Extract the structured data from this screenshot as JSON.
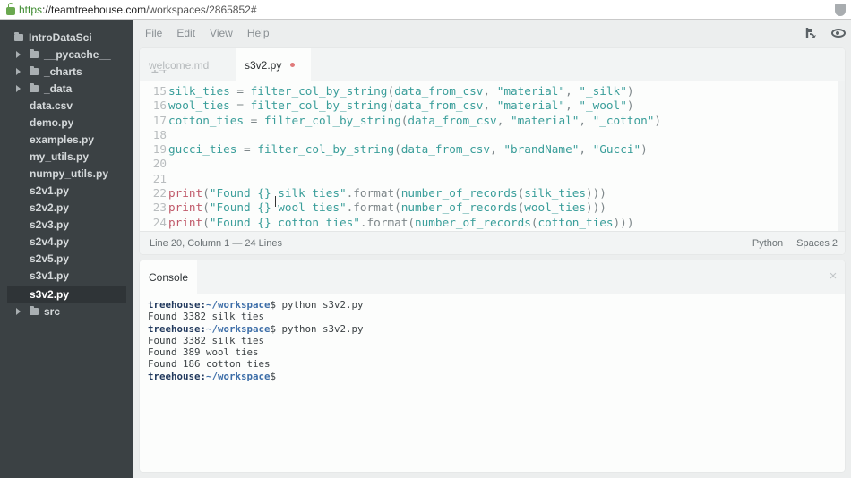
{
  "browser": {
    "url_scheme": "https",
    "url_host": "://teamtreehouse.com",
    "url_path": "/workspaces/2865852#"
  },
  "sidebar": {
    "items": [
      {
        "label": "IntroDataSci",
        "type": "root-folder",
        "expandable": false
      },
      {
        "label": "__pycache__",
        "type": "folder",
        "expandable": true
      },
      {
        "label": "_charts",
        "type": "folder",
        "expandable": true
      },
      {
        "label": "_data",
        "type": "folder",
        "expandable": true
      },
      {
        "label": "data.csv",
        "type": "file"
      },
      {
        "label": "demo.py",
        "type": "file"
      },
      {
        "label": "examples.py",
        "type": "file"
      },
      {
        "label": "my_utils.py",
        "type": "file"
      },
      {
        "label": "numpy_utils.py",
        "type": "file"
      },
      {
        "label": "s2v1.py",
        "type": "file"
      },
      {
        "label": "s2v2.py",
        "type": "file"
      },
      {
        "label": "s2v3.py",
        "type": "file"
      },
      {
        "label": "s2v4.py",
        "type": "file"
      },
      {
        "label": "s2v5.py",
        "type": "file"
      },
      {
        "label": "s3v1.py",
        "type": "file"
      },
      {
        "label": "s3v2.py",
        "type": "file",
        "selected": true
      },
      {
        "label": "src",
        "type": "folder",
        "expandable": true
      }
    ]
  },
  "menubar": {
    "items": [
      "File",
      "Edit",
      "View",
      "Help"
    ],
    "right_icons": [
      "share-icon",
      "preview-eye-icon"
    ]
  },
  "editor": {
    "tabs": [
      {
        "label": "welcome.md",
        "active": false
      },
      {
        "label": "s3v2.py",
        "active": true,
        "unsaved": true
      }
    ],
    "lines": [
      {
        "n": "15",
        "tokens": [
          [
            "id",
            "silk_ties"
          ],
          [
            "op",
            " = "
          ],
          [
            "id",
            "filter_col_by_string"
          ],
          [
            "op",
            "("
          ],
          [
            "id",
            "data_from_csv"
          ],
          [
            "op",
            ", "
          ],
          [
            "str",
            "\"material\""
          ],
          [
            "op",
            ", "
          ],
          [
            "str",
            "\"_silk\""
          ],
          [
            "op",
            ")"
          ]
        ]
      },
      {
        "n": "16",
        "tokens": [
          [
            "id",
            "wool_ties"
          ],
          [
            "op",
            " = "
          ],
          [
            "id",
            "filter_col_by_string"
          ],
          [
            "op",
            "("
          ],
          [
            "id",
            "data_from_csv"
          ],
          [
            "op",
            ", "
          ],
          [
            "str",
            "\"material\""
          ],
          [
            "op",
            ", "
          ],
          [
            "str",
            "\"_wool\""
          ],
          [
            "op",
            ")"
          ]
        ]
      },
      {
        "n": "17",
        "tokens": [
          [
            "id",
            "cotton_ties"
          ],
          [
            "op",
            " = "
          ],
          [
            "id",
            "filter_col_by_string"
          ],
          [
            "op",
            "("
          ],
          [
            "id",
            "data_from_csv"
          ],
          [
            "op",
            ", "
          ],
          [
            "str",
            "\"material\""
          ],
          [
            "op",
            ", "
          ],
          [
            "str",
            "\"_cotton\""
          ],
          [
            "op",
            ")"
          ]
        ]
      },
      {
        "n": "18",
        "tokens": []
      },
      {
        "n": "19",
        "tokens": [
          [
            "id",
            "gucci_ties"
          ],
          [
            "op",
            " = "
          ],
          [
            "id",
            "filter_col_by_string"
          ],
          [
            "op",
            "("
          ],
          [
            "id",
            "data_from_csv"
          ],
          [
            "op",
            ", "
          ],
          [
            "str",
            "\"brandName\""
          ],
          [
            "op",
            ", "
          ],
          [
            "str",
            "\"Gucci\""
          ],
          [
            "op",
            ")"
          ]
        ]
      },
      {
        "n": "20",
        "tokens": []
      },
      {
        "n": "21",
        "tokens": []
      },
      {
        "n": "22",
        "tokens": [
          [
            "kw",
            "print"
          ],
          [
            "op",
            "("
          ],
          [
            "str",
            "\"Found {} silk ties\""
          ],
          [
            "op",
            ".format("
          ],
          [
            "id",
            "number_of_records"
          ],
          [
            "op",
            "("
          ],
          [
            "id",
            "silk_ties"
          ],
          [
            "op",
            ")))"
          ]
        ]
      },
      {
        "n": "23",
        "tokens": [
          [
            "kw",
            "print"
          ],
          [
            "op",
            "("
          ],
          [
            "str",
            "\"Found {} wool ties\""
          ],
          [
            "op",
            ".format("
          ],
          [
            "id",
            "number_of_records"
          ],
          [
            "op",
            "("
          ],
          [
            "id",
            "wool_ties"
          ],
          [
            "op",
            ")))"
          ]
        ]
      },
      {
        "n": "24",
        "tokens": [
          [
            "kw",
            "print"
          ],
          [
            "op",
            "("
          ],
          [
            "str",
            "\"Found {} cotton ties\""
          ],
          [
            "op",
            ".format("
          ],
          [
            "id",
            "number_of_records"
          ],
          [
            "op",
            "("
          ],
          [
            "id",
            "cotton_ties"
          ],
          [
            "op",
            ")))"
          ]
        ]
      }
    ],
    "status": {
      "position": "Line 20, Column 1 — 24 Lines",
      "language": "Python",
      "indent": "Spaces 2"
    }
  },
  "console": {
    "title": "Console",
    "close_icon": "×",
    "lines": [
      {
        "type": "prompt",
        "host": "treehouse:",
        "path": "~/workspace",
        "dollar": "$",
        "cmd": " python s3v2.py"
      },
      {
        "type": "output",
        "text": "Found 3382 silk ties"
      },
      {
        "type": "prompt",
        "host": "treehouse:",
        "path": "~/workspace",
        "dollar": "$",
        "cmd": " python s3v2.py"
      },
      {
        "type": "output",
        "text": "Found 3382 silk ties"
      },
      {
        "type": "output",
        "text": "Found 389 wool ties"
      },
      {
        "type": "output",
        "text": "Found 186 cotton ties"
      },
      {
        "type": "prompt",
        "host": "treehouse:",
        "path": "~/workspace",
        "dollar": "$",
        "cmd": ""
      }
    ]
  },
  "colors": {
    "sidebar_bg": "#3b4144",
    "identifier": "#3a9e9a",
    "keyword": "#c05a6a",
    "unsaved_dot": "#e07a7a",
    "prompt_host": "#223a5e",
    "prompt_path": "#3d6ea8"
  }
}
